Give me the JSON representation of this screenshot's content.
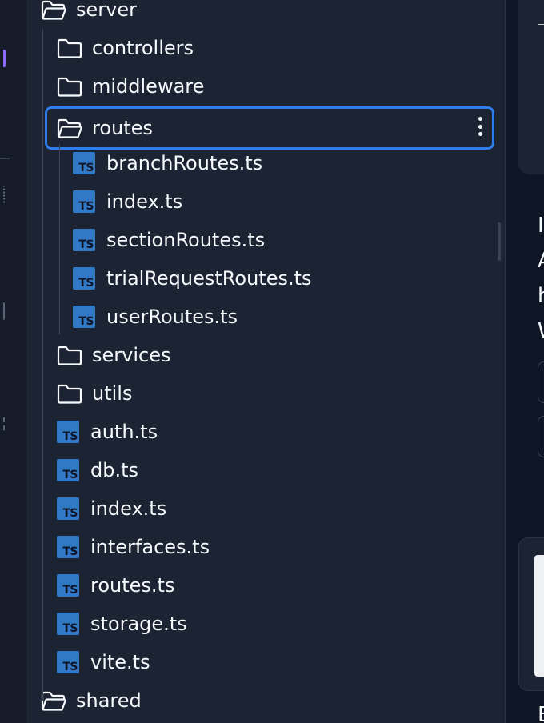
{
  "file_tree": {
    "items": [
      {
        "type": "folder",
        "label": "server",
        "depth": 0,
        "open": true
      },
      {
        "type": "folder",
        "label": "controllers",
        "depth": 1,
        "open": false
      },
      {
        "type": "folder",
        "label": "middleware",
        "depth": 1,
        "open": false
      },
      {
        "type": "folder",
        "label": "routes",
        "depth": 1,
        "open": true,
        "selected": true
      },
      {
        "type": "ts",
        "label": "branchRoutes.ts",
        "depth": 2
      },
      {
        "type": "ts",
        "label": "index.ts",
        "depth": 2
      },
      {
        "type": "ts",
        "label": "sectionRoutes.ts",
        "depth": 2
      },
      {
        "type": "ts",
        "label": "trialRequestRoutes.ts",
        "depth": 2
      },
      {
        "type": "ts",
        "label": "userRoutes.ts",
        "depth": 2
      },
      {
        "type": "folder",
        "label": "services",
        "depth": 1,
        "open": false
      },
      {
        "type": "folder",
        "label": "utils",
        "depth": 1,
        "open": false
      },
      {
        "type": "ts",
        "label": "auth.ts",
        "depth": 1
      },
      {
        "type": "ts",
        "label": "db.ts",
        "depth": 1
      },
      {
        "type": "ts",
        "label": "index.ts",
        "depth": 1
      },
      {
        "type": "ts",
        "label": "interfaces.ts",
        "depth": 1
      },
      {
        "type": "ts",
        "label": "routes.ts",
        "depth": 1
      },
      {
        "type": "ts",
        "label": "storage.ts",
        "depth": 1
      },
      {
        "type": "ts",
        "label": "vite.ts",
        "depth": 1
      },
      {
        "type": "folder",
        "label": "shared",
        "depth": 0,
        "open": true
      }
    ],
    "ts_badge": "TS"
  },
  "right_pane": {
    "text_lines": [
      "I",
      "A",
      "h",
      "W"
    ],
    "bottom_text": "E"
  },
  "colors": {
    "panel_bg": "#1c2333",
    "activity_bg": "#161b29",
    "right_bg": "#0e1525",
    "selection_border": "#2f7dea",
    "ts_blue": "#3178c6",
    "text": "#f5f9fc",
    "accent_purple": "#8c6bff"
  }
}
